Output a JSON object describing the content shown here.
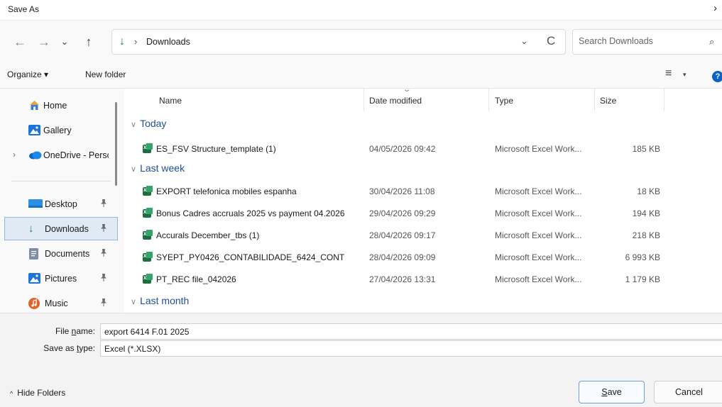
{
  "window": {
    "title": "Save As",
    "close_icon": "close-icon"
  },
  "nav": {
    "back_icon": "←",
    "forward_icon": "→",
    "recent_icon": "⌄",
    "up_icon": "↑",
    "address": {
      "location_icon": "↓",
      "separator": "›",
      "path": "Downloads",
      "dropdown_icon": "⌄",
      "refresh_icon": "C"
    },
    "search": {
      "placeholder": "Search Downloads",
      "icon": "⌕"
    }
  },
  "commands": {
    "organize": "Organize ▾",
    "new_folder": "New folder",
    "view_icon": "≡",
    "view_dropdown": "▾",
    "help": "?"
  },
  "sidebar": {
    "items": [
      {
        "label": "Home",
        "icon": "home-icon"
      },
      {
        "label": "Gallery",
        "icon": "gallery-icon"
      },
      {
        "label": "OneDrive - Perso",
        "icon": "cloud-icon",
        "expand": "›"
      },
      {
        "label": "Desktop",
        "icon": "desktop-icon",
        "pinned": true
      },
      {
        "label": "Downloads",
        "icon": "download-icon",
        "pinned": true,
        "selected": true
      },
      {
        "label": "Documents",
        "icon": "documents-icon",
        "pinned": true
      },
      {
        "label": "Pictures",
        "icon": "pictures-icon",
        "pinned": true
      },
      {
        "label": "Music",
        "icon": "music-icon",
        "pinned": true
      }
    ],
    "pin_glyph": "📌"
  },
  "files": {
    "columns": {
      "name": "Name",
      "date": "Date modified",
      "type": "Type",
      "size": "Size"
    },
    "groups": [
      {
        "label": "Today",
        "chevron": "∨"
      },
      {
        "label": "Last week",
        "chevron": "∨"
      },
      {
        "label": "Last month",
        "chevron": "∨"
      }
    ],
    "rows": [
      {
        "name": "ES_FSV Structure_template (1)",
        "date": "04/05/2026 09:42",
        "type": "Microsoft Excel Work...",
        "size": "185 KB"
      },
      {
        "name": "EXPORT telefonica mobiles espanha",
        "date": "30/04/2026 11:08",
        "type": "Microsoft Excel Work...",
        "size": "18 KB"
      },
      {
        "name": "Bonus Cadres accruals 2025 vs payment 04.2026",
        "date": "29/04/2026 09:29",
        "type": "Microsoft Excel Work...",
        "size": "194 KB"
      },
      {
        "name": "Accurals December_tbs (1)",
        "date": "28/04/2026 09:17",
        "type": "Microsoft Excel Work...",
        "size": "218 KB"
      },
      {
        "name": "SYEPT_PY0426_CONTABILIDADE_6424_CONT",
        "date": "28/04/2026 09:09",
        "type": "Microsoft Excel Work...",
        "size": "6 993 KB"
      },
      {
        "name": "PT_REC file_042026",
        "date": "27/04/2026 13:31",
        "type": "Microsoft Excel Work...",
        "size": "1 179 KB"
      }
    ]
  },
  "form": {
    "file_name_label_pre": "File ",
    "file_name_label_u": "n",
    "file_name_label_post": "ame:",
    "file_name_value": "export 6414 F.01 2025",
    "save_type_label_pre": "Save as ",
    "save_type_label_u": "t",
    "save_type_label_post": "ype:",
    "save_type_value": "Excel (*.XLSX)"
  },
  "footer": {
    "hide_folders_caret": "^",
    "hide_folders": "Hide Folders",
    "save_u": "S",
    "save_rest": "ave",
    "cancel": "Cancel"
  }
}
